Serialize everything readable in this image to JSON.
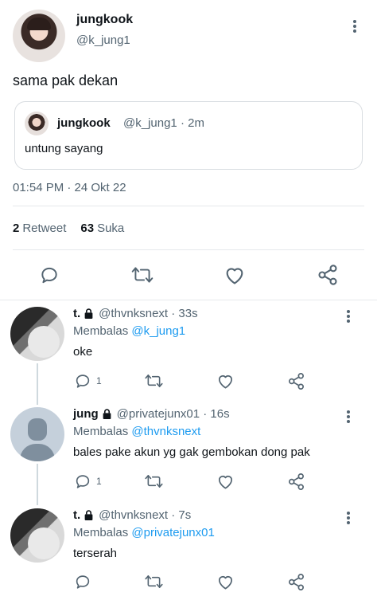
{
  "tweet": {
    "author_name": "jungkook",
    "author_handle": "@k_jung1",
    "text": "sama pak dekan",
    "quote": {
      "author_name": "jungkook",
      "author_handle": "@k_jung1 · 2m",
      "text": "untung sayang"
    },
    "timestamp": "01:54 PM · 24 Okt 22",
    "retweets_count": "2",
    "retweets_label": "Retweet",
    "likes_count": "63",
    "likes_label": "Suka"
  },
  "replies": [
    {
      "name": "t.",
      "handle": "@thvnksnext · 33s",
      "reply_prefix": "Membalas",
      "reply_to": "@k_jung1",
      "text": "oke",
      "reply_count": "1",
      "avatar": "photo-avatar"
    },
    {
      "name": "jung",
      "handle": "@privatejunx01 · 16s",
      "reply_prefix": "Membalas",
      "reply_to": "@thvnksnext",
      "text": "bales pake akun yg gak gembokan dong pak",
      "reply_count": "1",
      "avatar": "default-avatar"
    },
    {
      "name": "t.",
      "handle": "@thvnksnext · 7s",
      "reply_prefix": "Membalas",
      "reply_to": "@privatejunx01",
      "text": "terserah",
      "reply_count": "",
      "avatar": "photo-avatar"
    }
  ],
  "icons": [
    "more-vertical-icon",
    "reply-icon",
    "retweet-icon",
    "like-icon",
    "share-icon",
    "lock-icon"
  ],
  "colors": {
    "text": "#0f1419",
    "secondary": "#536471",
    "mention": "#1d9bf0",
    "divider": "#e6e9ec"
  }
}
